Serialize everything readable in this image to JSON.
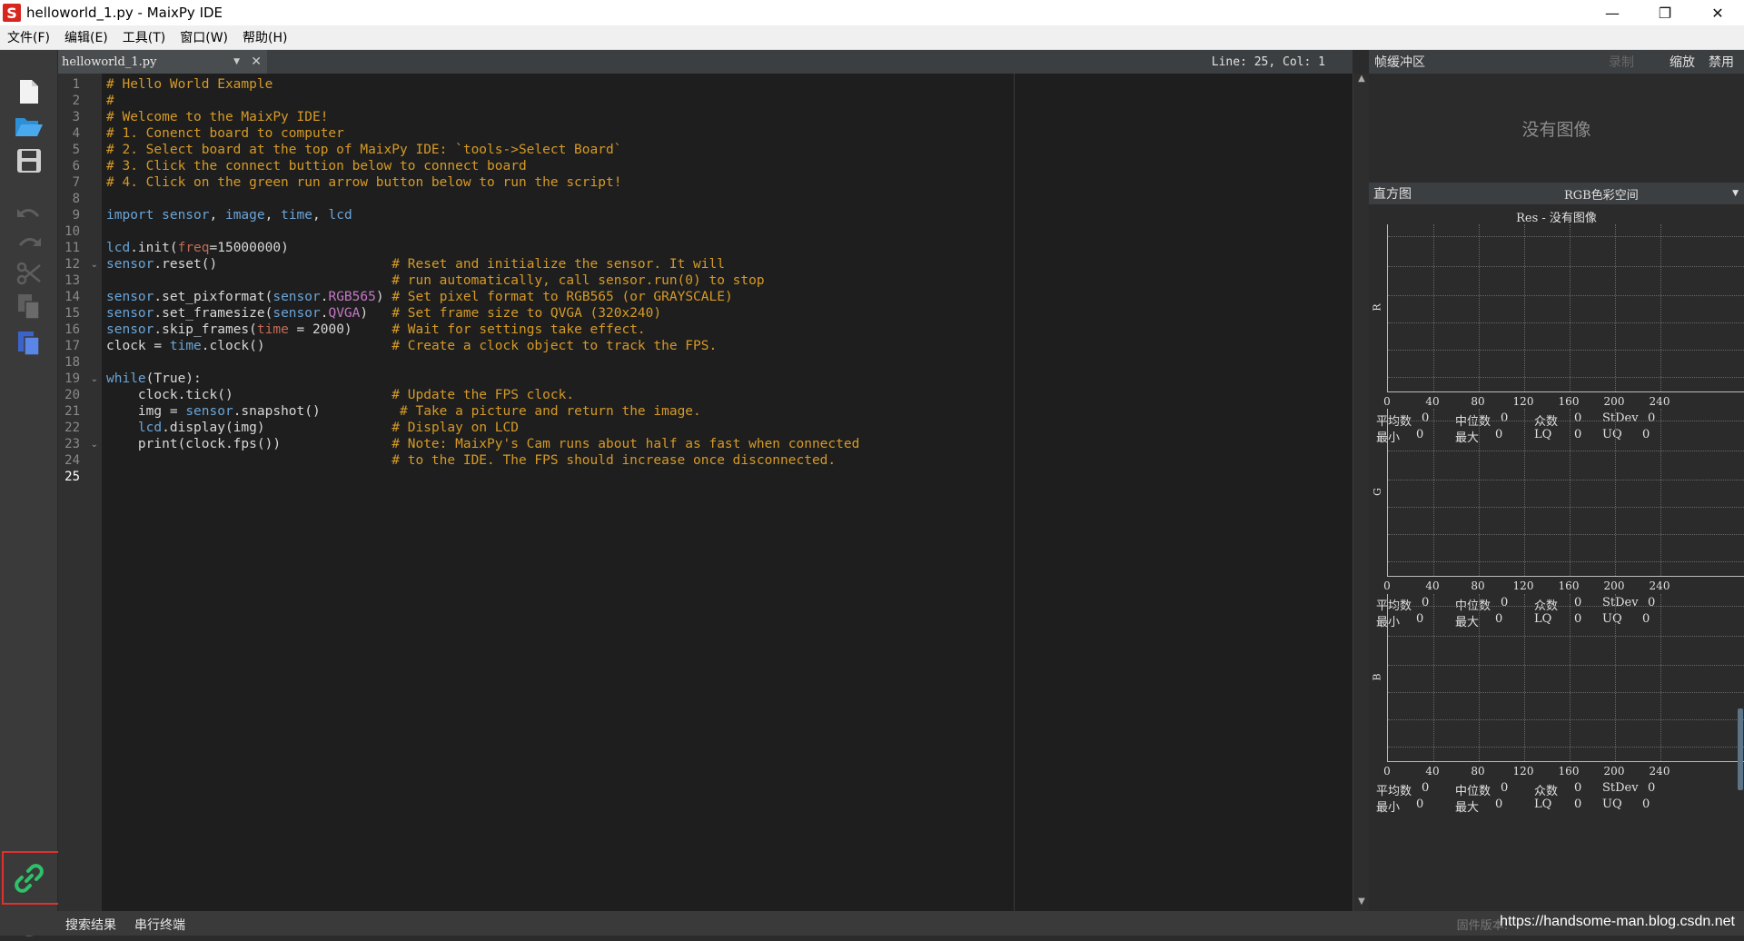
{
  "window": {
    "title": "helloworld_1.py - MaixPy IDE",
    "minimize": "—",
    "restore": "❐",
    "close": "✕"
  },
  "menu": [
    "文件(F)",
    "编辑(E)",
    "工具(T)",
    "窗口(W)",
    "帮助(H)"
  ],
  "editor": {
    "file_tab": "helloworld_1.py",
    "cursor": "Line: 25, Col: 1",
    "lines": [
      [
        [
          "# Hello World Example",
          "comment"
        ]
      ],
      [
        [
          "#",
          "comment"
        ]
      ],
      [
        [
          "# Welcome to the MaixPy IDE!",
          "comment"
        ]
      ],
      [
        [
          "# 1. Conenct board to computer",
          "comment"
        ]
      ],
      [
        [
          "# 2. Select board at the top of MaixPy IDE: `tools->Select Board`",
          "comment"
        ]
      ],
      [
        [
          "# 3. Click the connect buttion below to connect board",
          "comment"
        ]
      ],
      [
        [
          "# 4. Click on the green run arrow button below to run the script!",
          "comment"
        ]
      ],
      [],
      [
        [
          "import ",
          "kw"
        ],
        [
          "sensor",
          "mod"
        ],
        [
          ", ",
          "plain"
        ],
        [
          "image",
          "mod"
        ],
        [
          ", ",
          "plain"
        ],
        [
          "time",
          "mod"
        ],
        [
          ", ",
          "plain"
        ],
        [
          "lcd",
          "mod"
        ]
      ],
      [],
      [
        [
          "lcd",
          "mod"
        ],
        [
          ".init(",
          "plain"
        ],
        [
          "freq",
          "param"
        ],
        [
          "=15000000)",
          "plain"
        ]
      ],
      [
        [
          "sensor",
          "mod"
        ],
        [
          ".reset()                      ",
          "plain"
        ],
        [
          "# Reset and initialize the sensor. It will",
          "comment"
        ]
      ],
      [
        [
          "                                    ",
          "plain"
        ],
        [
          "# run automatically, call sensor.run(0) to stop",
          "comment"
        ]
      ],
      [
        [
          "sensor",
          "mod"
        ],
        [
          ".set_pixformat(",
          "plain"
        ],
        [
          "sensor",
          "mod"
        ],
        [
          ".",
          "plain"
        ],
        [
          "RGB565",
          "const"
        ],
        [
          ") ",
          "plain"
        ],
        [
          "# Set pixel format to RGB565 (or GRAYSCALE)",
          "comment"
        ]
      ],
      [
        [
          "sensor",
          "mod"
        ],
        [
          ".set_framesize(",
          "plain"
        ],
        [
          "sensor",
          "mod"
        ],
        [
          ".",
          "plain"
        ],
        [
          "QVGA",
          "const"
        ],
        [
          ")   ",
          "plain"
        ],
        [
          "# Set frame size to QVGA (320x240)",
          "comment"
        ]
      ],
      [
        [
          "sensor",
          "mod"
        ],
        [
          ".skip_frames(",
          "plain"
        ],
        [
          "time",
          "param"
        ],
        [
          " = 2000)     ",
          "plain"
        ],
        [
          "# Wait for settings take effect.",
          "comment"
        ]
      ],
      [
        [
          "clock",
          "plain"
        ],
        [
          " = ",
          "plain"
        ],
        [
          "time",
          "mod"
        ],
        [
          ".clock()                ",
          "plain"
        ],
        [
          "# Create a clock object to track the FPS.",
          "comment"
        ]
      ],
      [],
      [
        [
          "while",
          "kw"
        ],
        [
          "(True):",
          "plain"
        ]
      ],
      [
        [
          "    clock.tick()                    ",
          "plain"
        ],
        [
          "# Update the FPS clock.",
          "comment"
        ]
      ],
      [
        [
          "    img = ",
          "plain"
        ],
        [
          "sensor",
          "mod"
        ],
        [
          ".snapshot()          ",
          "plain"
        ],
        [
          "# Take a picture and return the image.",
          "comment"
        ]
      ],
      [
        [
          "    ",
          "plain"
        ],
        [
          "lcd",
          "mod"
        ],
        [
          ".display(img)                ",
          "plain"
        ],
        [
          "# Display on LCD",
          "comment"
        ]
      ],
      [
        [
          "    print(clock.fps())              ",
          "plain"
        ],
        [
          "# Note: MaixPy's Cam runs about half as fast when connected",
          "comment"
        ]
      ],
      [
        [
          "                                    ",
          "plain"
        ],
        [
          "# to the IDE. The FPS should increase once disconnected.",
          "comment"
        ]
      ],
      []
    ],
    "fold_lines": [
      12,
      19,
      23
    ],
    "active_line": 25
  },
  "framebuffer": {
    "title": "帧缓冲区",
    "record": "录制",
    "zoom": "缩放",
    "disable": "禁用",
    "empty": "没有图像"
  },
  "histogram": {
    "title": "直方图",
    "colorspace": "RGB色彩空间",
    "res": "Res - 没有图像",
    "ticks": [
      "0",
      "40",
      "80",
      "120",
      "160",
      "200",
      "240"
    ],
    "channels": [
      {
        "name": "R",
        "mean": "0",
        "median": "0",
        "mode": "0",
        "stdev": "0",
        "min": "0",
        "max": "0",
        "lq": "0",
        "uq": "0"
      },
      {
        "name": "G",
        "mean": "0",
        "median": "0",
        "mode": "0",
        "stdev": "0",
        "min": "0",
        "max": "0",
        "lq": "0",
        "uq": "0"
      },
      {
        "name": "B",
        "mean": "0",
        "median": "0",
        "mode": "0",
        "stdev": "0",
        "min": "0",
        "max": "0",
        "lq": "0",
        "uq": "0"
      }
    ],
    "labels": {
      "mean": "平均数",
      "median": "中位数",
      "mode": "众数",
      "stdev": "StDev",
      "min": "最小",
      "max": "最大",
      "lq": "LQ",
      "uq": "UQ"
    }
  },
  "statusbar": {
    "search": "搜索结果",
    "serial": "串行终端",
    "firmware": "固件版本:",
    "watermark": "https://handsome-man.blog.csdn.net"
  },
  "colors": {
    "comment": "#d69a26",
    "kw": "#6aa5d8",
    "mod": "#6aa5d8",
    "param": "#c46a55",
    "const": "#c477c5",
    "plain": "#d8d8d8",
    "accent_connect": "#2fc16a",
    "annotation": "#e03030"
  }
}
